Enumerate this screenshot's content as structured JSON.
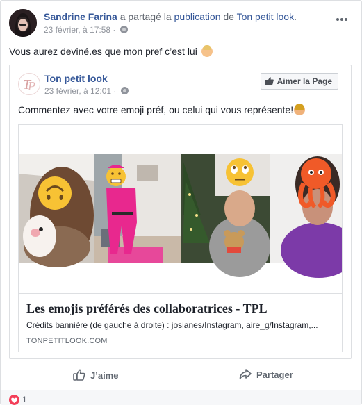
{
  "post": {
    "author": "Sandrine Farina",
    "shared_text": "a partagé la",
    "publication_link": "publication",
    "of_text": "de",
    "page_link": "Ton petit look",
    "page_link_suffix": ".",
    "timestamp": "23 février, à 17:58 ·",
    "message": "Vous aurez deviné.es que mon pref c’est lui",
    "message_emoji": "woman-emoji"
  },
  "shared_post": {
    "page_name": "Ton petit look",
    "timestamp": "23 février, à 12:01 ·",
    "like_page_label": "Aimer la Page",
    "message": "Commentez avec votre emoji préf, ou celui qui vous représente!",
    "message_emoji": "woman-raising-hand-emoji"
  },
  "link_card": {
    "title": "Les emojis préférés des collaboratrices - TPL",
    "description": "Crédits bannière (de gauche à droite) : josianes/Instagram, aire_g/Instagram,...",
    "domain": "TONPETITLOOK.COM"
  },
  "actions": {
    "like_label": "J’aime",
    "share_label": "Partager"
  },
  "reactions": {
    "count": "1",
    "type": "heart-icon"
  },
  "colors": {
    "link": "#365899",
    "muted": "#90949c",
    "heart": "#f33e58",
    "pink_outfit": "#e8288e",
    "emoji_yellow": "#f7c234",
    "octopus": "#f05a28"
  }
}
